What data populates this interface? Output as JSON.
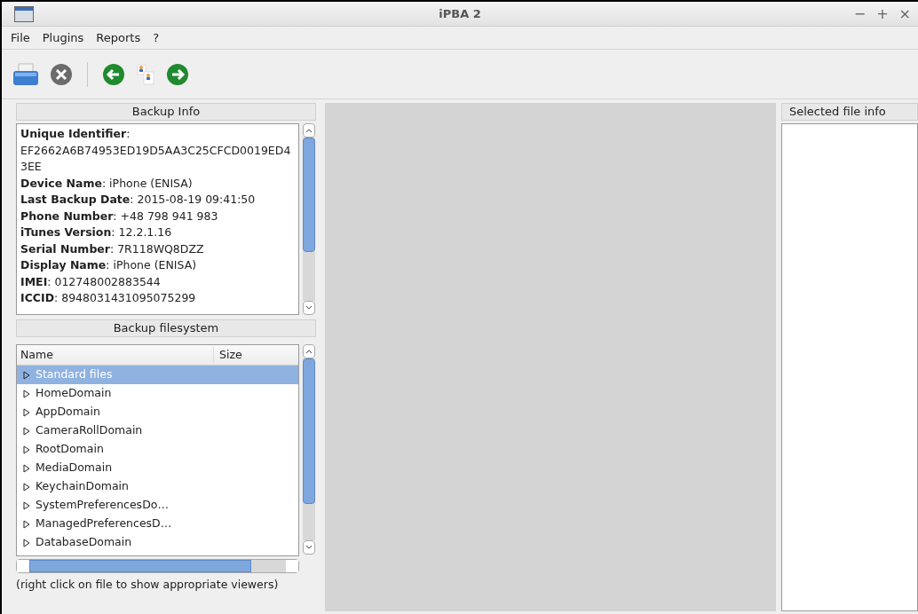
{
  "window": {
    "title": "iPBA 2",
    "controls": [
      "−",
      "+",
      "×"
    ]
  },
  "menu": [
    "File",
    "Plugins",
    "Reports",
    "?"
  ],
  "toolbar": [
    {
      "kind": "print"
    },
    {
      "kind": "stop"
    },
    {
      "kind": "separator"
    },
    {
      "kind": "back"
    },
    {
      "kind": "users"
    },
    {
      "kind": "forward"
    }
  ],
  "backup_info": {
    "title": "Backup Info",
    "lines": [
      "**Unique Identifier**: EF2662A6B74953ED19D5AA3C25CFCD0019ED43EE",
      "**Device Name**: iPhone (ENISA)",
      "**Last Backup Date**: 2015-08-19 09:41:50",
      "**Phone Number**: +48 798 941 983",
      "**iTunes Version**: 12.2.1.16",
      "**Serial Number**: 7R118WQ8DZZ",
      "**Display Name**: iPhone (ENISA)",
      "**IMEI**: 012748002883544",
      "**ICCID**: 8948031431095075299"
    ]
  },
  "backup_filesystem": {
    "title": "Backup filesystem",
    "columns": [
      "Name",
      "Size"
    ],
    "items": [
      {
        "name": "Standard files",
        "selected": true,
        "expanded": false
      },
      {
        "name": "HomeDomain",
        "selected": false,
        "expanded": false
      },
      {
        "name": "AppDomain",
        "selected": false,
        "expanded": false
      },
      {
        "name": "CameraRollDomain",
        "selected": false,
        "expanded": false
      },
      {
        "name": "RootDomain",
        "selected": false,
        "expanded": false
      },
      {
        "name": "MediaDomain",
        "selected": false,
        "expanded": false
      },
      {
        "name": "KeychainDomain",
        "selected": false,
        "expanded": false
      },
      {
        "name": "SystemPreferencesDo…",
        "selected": false,
        "expanded": false
      },
      {
        "name": "ManagedPreferencesD…",
        "selected": false,
        "expanded": false
      },
      {
        "name": "DatabaseDomain",
        "selected": false,
        "expanded": false
      }
    ],
    "hint": "(right click on file to show appropriate viewers)"
  },
  "selected_file_info": {
    "title": "Selected file info"
  }
}
